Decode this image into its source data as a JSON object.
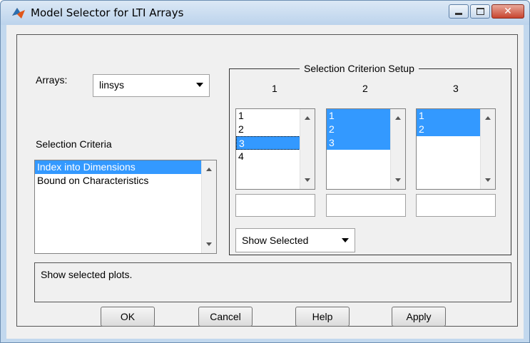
{
  "window": {
    "title": "Model Selector for LTI Arrays",
    "controls": {
      "minimize": "minimize",
      "maximize": "maximize",
      "close": "close"
    }
  },
  "arrays": {
    "label": "Arrays:",
    "selected": "linsys"
  },
  "criteria": {
    "label": "Selection Criteria",
    "items": [
      "Index into Dimensions",
      "Bound on Characteristics"
    ],
    "selected_index": 0
  },
  "setup": {
    "title": "Selection Criterion Setup",
    "columns": [
      {
        "header": "1",
        "items": [
          "1",
          "2",
          "3",
          "4"
        ],
        "selected": [
          2
        ]
      },
      {
        "header": "2",
        "items": [
          "1",
          "2",
          "3"
        ],
        "selected": [
          0,
          1,
          2
        ]
      },
      {
        "header": "3",
        "items": [
          "1",
          "2"
        ],
        "selected": [
          0,
          1
        ]
      }
    ],
    "show_mode": "Show Selected"
  },
  "status": {
    "text": "Show selected plots."
  },
  "buttons": {
    "ok": "OK",
    "cancel": "Cancel",
    "help": "Help",
    "apply": "Apply"
  },
  "colors": {
    "selection": "#3399ff",
    "title_bar": "#c2d8ee",
    "close_button": "#c8452f"
  }
}
